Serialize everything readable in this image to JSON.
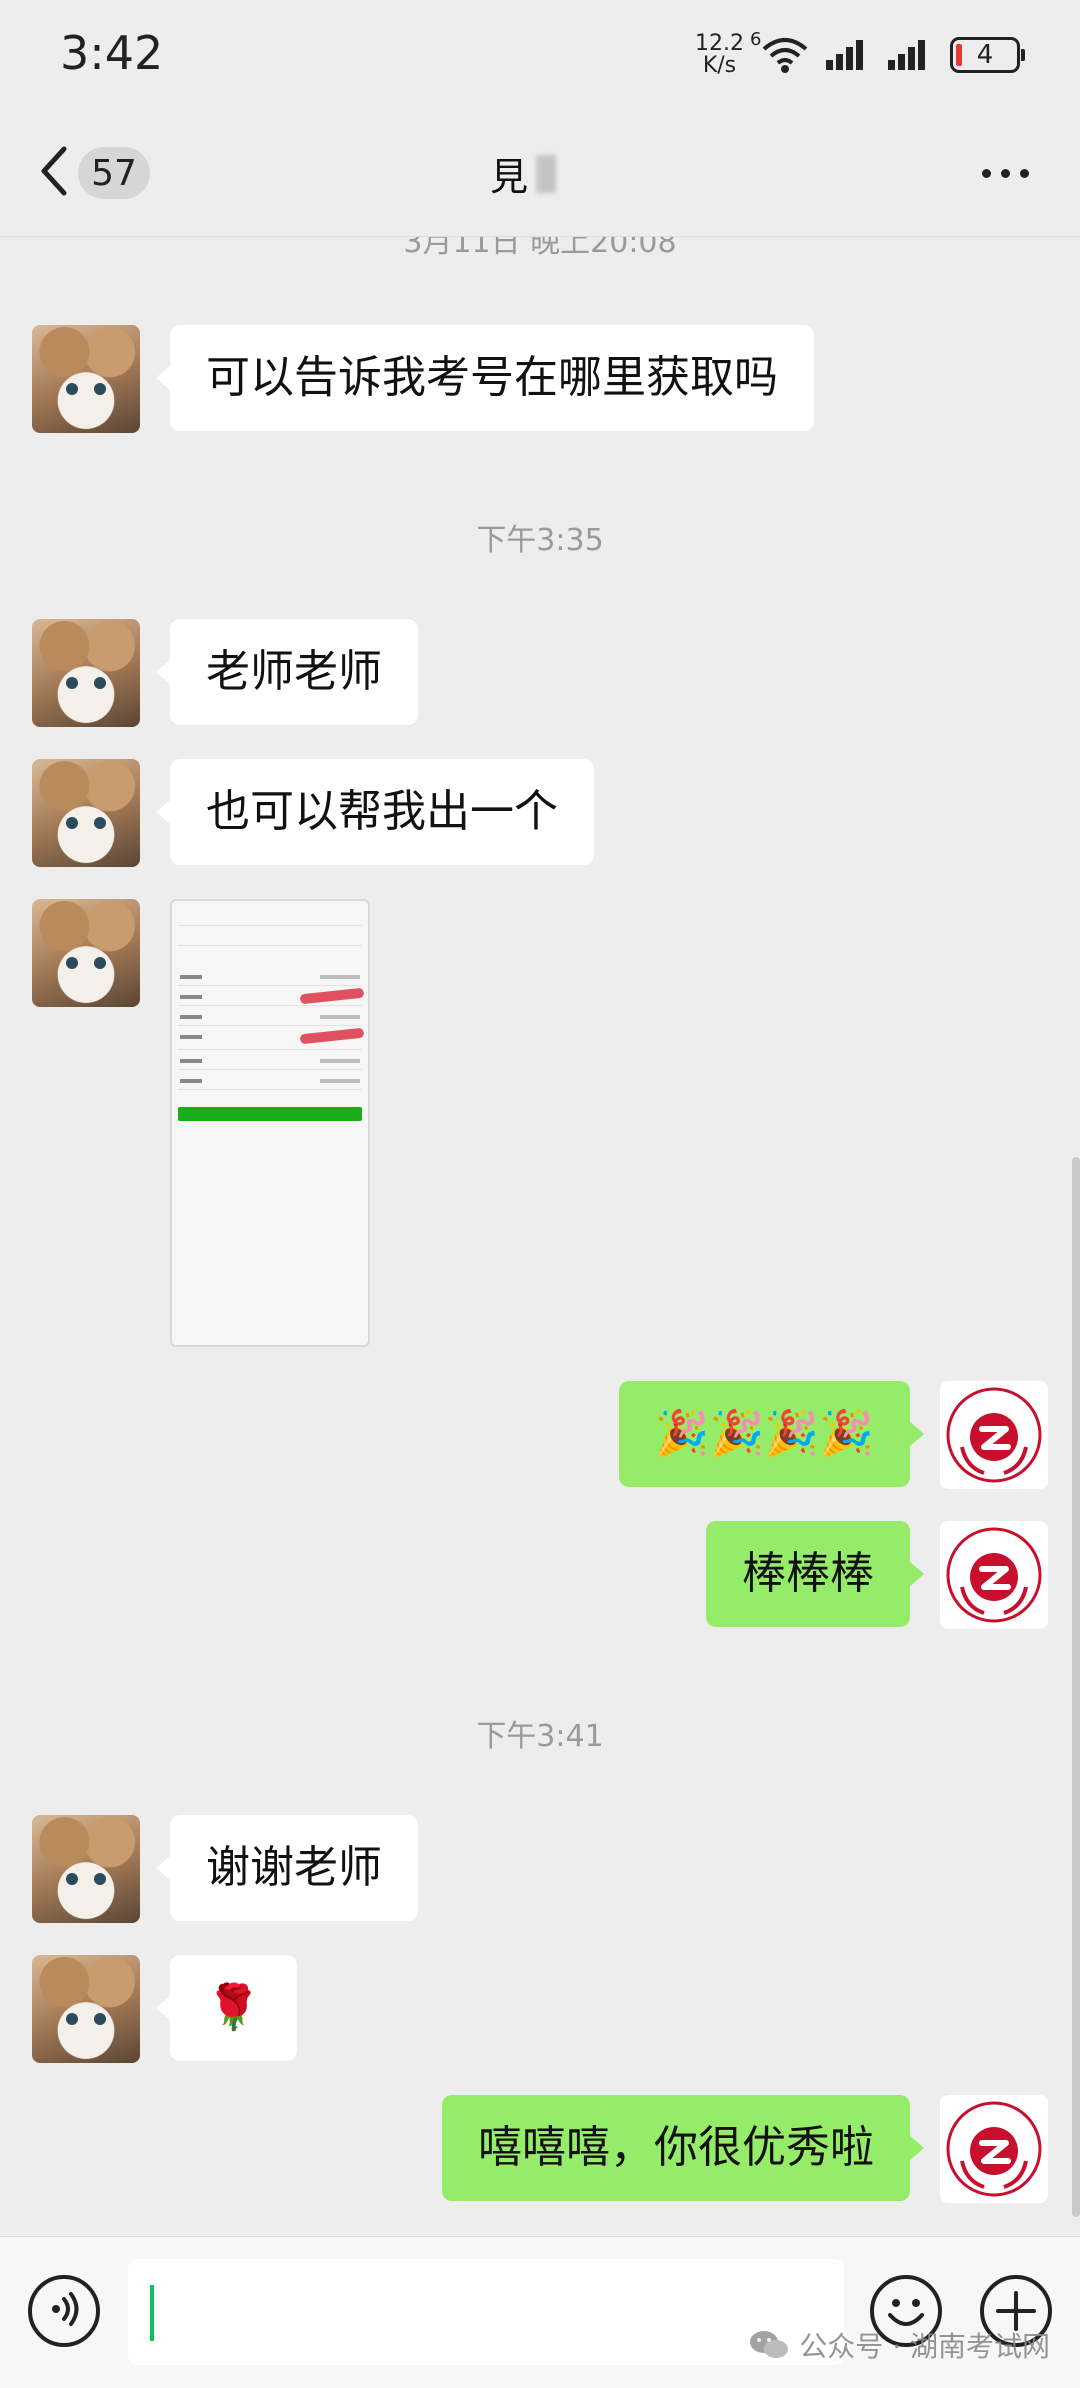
{
  "status_bar": {
    "time": "3:42",
    "net_speed_value": "12.2",
    "net_speed_unit": "K/s",
    "wifi_badge": "6",
    "battery_level": "4"
  },
  "nav": {
    "back_count": "57",
    "title_char": "見"
  },
  "chat": {
    "partial_time": "3月11日 晚上20:08",
    "messages": [
      {
        "text": "可以告诉我考号在哪里获取吗"
      },
      {
        "text": "老师老师"
      },
      {
        "text": "也可以帮我出一个"
      },
      {
        "text": "🎉🎉🎉🎉"
      },
      {
        "text": "棒棒棒"
      },
      {
        "text": "谢谢老师"
      },
      {
        "text": "🌹"
      },
      {
        "text": "嘻嘻嘻，你很优秀啦"
      }
    ],
    "time_separators": [
      "下午3:35",
      "下午3:41"
    ]
  },
  "input_bar": {
    "placeholder": "",
    "watermark_text": "公众号 · 湖南考试网"
  },
  "colors": {
    "background": "#ededed",
    "bubble_self": "#95ec69",
    "bubble_other": "#ffffff",
    "accent_green": "#07c160"
  },
  "icons": {
    "back": "chevron-left-icon",
    "more": "ellipsis-icon",
    "voice": "voice-icon",
    "emoji": "smiley-icon",
    "plus": "plus-icon",
    "wechat": "wechat-icon"
  }
}
